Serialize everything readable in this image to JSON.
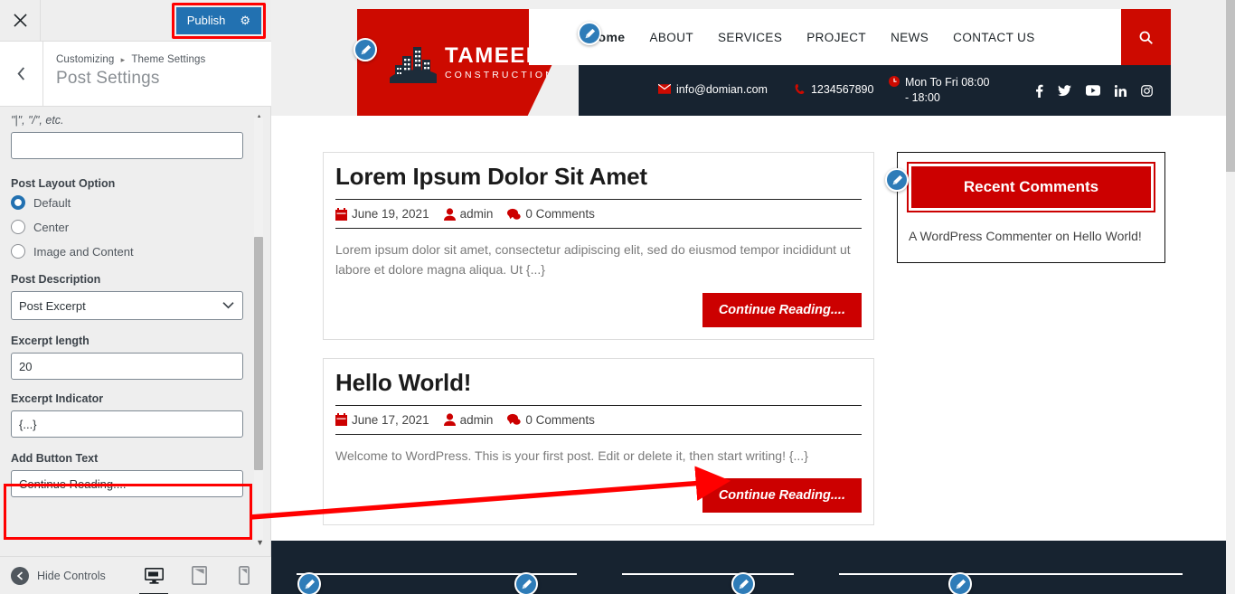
{
  "customizer": {
    "close_icon": "close-icon",
    "publish_label": "Publish",
    "gear_icon": "gear-icon",
    "back_icon": "chevron-left-icon",
    "breadcrumb_root": "Customizing",
    "breadcrumb_sep": "▸",
    "breadcrumb_parent": "Theme Settings",
    "section_title": "Post Settings",
    "helper_note": "\"|\", \"/\", etc.",
    "separator_value": "",
    "post_layout": {
      "label": "Post Layout Option",
      "options": [
        {
          "label": "Default",
          "selected": true
        },
        {
          "label": "Center",
          "selected": false
        },
        {
          "label": "Image and Content",
          "selected": false
        }
      ]
    },
    "post_description": {
      "label": "Post Description",
      "value": "Post Excerpt"
    },
    "excerpt_length": {
      "label": "Excerpt length",
      "value": "20"
    },
    "excerpt_indicator": {
      "label": "Excerpt Indicator",
      "value": "{...}"
    },
    "add_button_text": {
      "label": "Add Button Text",
      "value": "Continue Reading...."
    },
    "footer": {
      "hide_controls_label": "Hide Controls",
      "devices": [
        {
          "name": "desktop",
          "active": true
        },
        {
          "name": "tablet",
          "active": false
        },
        {
          "name": "mobile",
          "active": false
        }
      ]
    }
  },
  "preview": {
    "header": {
      "brand_top": "TAMEER",
      "brand_bottom": "CONSTRUCTION",
      "nav": [
        {
          "label": "Home"
        },
        {
          "label": "ABOUT"
        },
        {
          "label": "SERVICES"
        },
        {
          "label": "PROJECT"
        },
        {
          "label": "NEWS"
        },
        {
          "label": "CONTACT US"
        }
      ],
      "search_icon": "search-icon",
      "email": "info@domian.com",
      "phone": "1234567890",
      "hours": "Mon To Fri 08:00 - 18:00",
      "socials": [
        "facebook-icon",
        "twitter-icon",
        "youtube-icon",
        "linkedin-icon",
        "instagram-icon"
      ]
    },
    "posts": [
      {
        "title": "Lorem Ipsum Dolor Sit Amet",
        "date": "June 19, 2021",
        "author": "admin",
        "comments": "0 Comments",
        "excerpt": "Lorem ipsum dolor sit amet, consectetur adipiscing elit, sed do eiusmod tempor incididunt ut labore et dolore magna aliqua. Ut {...}",
        "button": "Continue Reading...."
      },
      {
        "title": "Hello World!",
        "date": "June 17, 2021",
        "author": "admin",
        "comments": "0 Comments",
        "excerpt": "Welcome to WordPress. This is your first post. Edit or delete it, then start writing! {...}",
        "button": "Continue Reading...."
      }
    ],
    "widget": {
      "title": "Recent Comments",
      "body": "A WordPress Commenter on Hello World!"
    }
  },
  "colors": {
    "brand_red": "#cd0a00",
    "button_red": "#cc0000",
    "dark_navy": "#172330",
    "publish_blue": "#2271b1",
    "annotation_red": "#ff0000",
    "pencil_blue": "#2e7cb8"
  }
}
